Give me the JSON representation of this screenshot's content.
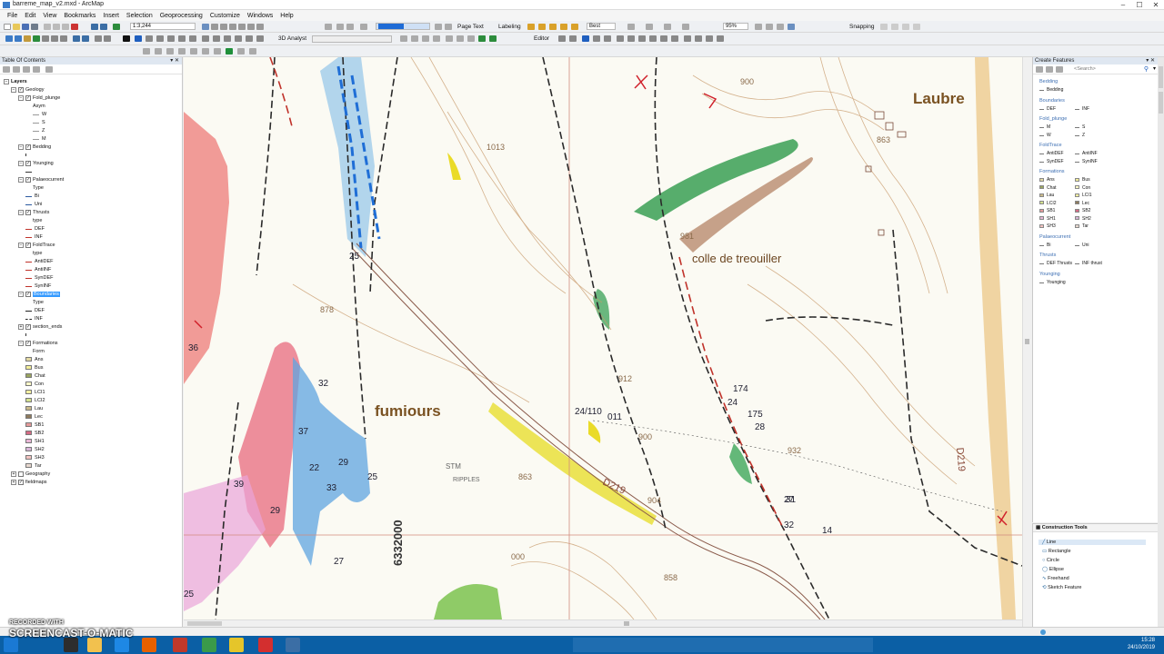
{
  "window": {
    "title": "barreme_map_v2.mxd - ArcMap"
  },
  "menu": [
    "File",
    "Edit",
    "View",
    "Bookmarks",
    "Insert",
    "Selection",
    "Geoprocessing",
    "Customize",
    "Windows",
    "Help"
  ],
  "toolbar": {
    "scale_value": "1:3,244",
    "page_text_label": "Page Text",
    "labeling_label": "Labeling",
    "best_label": "Best",
    "analyst_label": "3D Analyst",
    "editor_label": "Editor",
    "snapping_label": "Snapping",
    "zoom_value": "95%"
  },
  "toc": {
    "title": "Table Of Contents",
    "rows": [
      {
        "indent": 1,
        "expand": "-",
        "check": "",
        "label": "Layers",
        "bold": true
      },
      {
        "indent": 2,
        "expand": "-",
        "check": "✓",
        "label": "Geology"
      },
      {
        "indent": 3,
        "expand": "-",
        "check": "✓",
        "label": "Fold_plunge"
      },
      {
        "indent": 5,
        "label": "Asym"
      },
      {
        "indent": 5,
        "sym": "line-grey",
        "label": "W"
      },
      {
        "indent": 5,
        "sym": "line-grey",
        "label": "S"
      },
      {
        "indent": 5,
        "sym": "line-grey",
        "label": "Z"
      },
      {
        "indent": 5,
        "sym": "line-grey",
        "label": "M"
      },
      {
        "indent": 3,
        "expand": "-",
        "check": "✓",
        "label": "Bedding"
      },
      {
        "indent": 4,
        "sym": "tick",
        "label": ""
      },
      {
        "indent": 3,
        "expand": "-",
        "check": "✓",
        "label": "Younging"
      },
      {
        "indent": 4,
        "sym": "arrow",
        "label": ""
      },
      {
        "indent": 3,
        "expand": "-",
        "check": "✓",
        "label": "Palaeocurrent"
      },
      {
        "indent": 5,
        "label": "Type"
      },
      {
        "indent": 4,
        "sym": "line-blue",
        "label": "Bi"
      },
      {
        "indent": 4,
        "sym": "line-blue",
        "label": "Uni"
      },
      {
        "indent": 3,
        "expand": "-",
        "check": "✓",
        "label": "Thrusts"
      },
      {
        "indent": 5,
        "label": "type"
      },
      {
        "indent": 4,
        "sym": "line-red",
        "label": "DEF"
      },
      {
        "indent": 4,
        "sym": "line-red",
        "label": "INF"
      },
      {
        "indent": 3,
        "expand": "-",
        "check": "✓",
        "label": "FoldTrace"
      },
      {
        "indent": 5,
        "label": "type"
      },
      {
        "indent": 4,
        "sym": "line-red",
        "label": "AntiDEF"
      },
      {
        "indent": 4,
        "sym": "line-red",
        "label": "AntiINF"
      },
      {
        "indent": 4,
        "sym": "line-red",
        "label": "SynDEF"
      },
      {
        "indent": 4,
        "sym": "line-red",
        "label": "SynINF"
      },
      {
        "indent": 3,
        "expand": "-",
        "check": "✓",
        "label": "Boundaries",
        "selected": true
      },
      {
        "indent": 5,
        "label": "Type"
      },
      {
        "indent": 4,
        "sym": "line-black",
        "label": "DEF"
      },
      {
        "indent": 4,
        "sym": "line-dash",
        "label": "INF"
      },
      {
        "indent": 3,
        "expand": "+",
        "check": "✓",
        "label": "section_ends"
      },
      {
        "indent": 4,
        "sym": "tick",
        "label": ""
      },
      {
        "indent": 3,
        "expand": "-",
        "check": "✓",
        "label": "Formations"
      },
      {
        "indent": 5,
        "label": "Form"
      },
      {
        "indent": 4,
        "color": "#e3d9a5",
        "label": "Ans"
      },
      {
        "indent": 4,
        "color": "#f3ee9a",
        "label": "Bus"
      },
      {
        "indent": 4,
        "color": "#9aa560",
        "label": "Chat"
      },
      {
        "indent": 4,
        "color": "#fbf8c8",
        "label": "Con"
      },
      {
        "indent": 4,
        "color": "#f3efa1",
        "label": "LCI1"
      },
      {
        "indent": 4,
        "color": "#d3e18e",
        "label": "LCI2"
      },
      {
        "indent": 4,
        "color": "#c9b98a",
        "label": "Lau"
      },
      {
        "indent": 4,
        "color": "#8f7b5e",
        "label": "Lec"
      },
      {
        "indent": 4,
        "color": "#e39a9a",
        "label": "SB1"
      },
      {
        "indent": 4,
        "color": "#d56b84",
        "label": "SB2"
      },
      {
        "indent": 4,
        "color": "#e7b7d6",
        "label": "SH1"
      },
      {
        "indent": 4,
        "color": "#d8b6d8",
        "label": "SH2"
      },
      {
        "indent": 4,
        "color": "#f2c3c0",
        "label": "SH3"
      },
      {
        "indent": 4,
        "color": "#e7d8cf",
        "label": "Tar"
      },
      {
        "indent": 2,
        "expand": "+",
        "check": "",
        "label": "Geography"
      },
      {
        "indent": 2,
        "expand": "+",
        "check": "✓",
        "label": "fieldmaps"
      }
    ]
  },
  "map": {
    "labels": {
      "laubre": "Laubre",
      "colle": "colle de treouiller",
      "fumiours": "fumiours",
      "northing": "6332000",
      "d219": "D219",
      "d219b": "D219",
      "stm": "STM",
      "ripples": "RIPPLES"
    },
    "spot_heights": [
      "1013",
      "981",
      "878",
      "912",
      "900",
      "863",
      "932",
      "858",
      "904",
      "863",
      "900",
      "000"
    ],
    "dips": [
      "32",
      "37",
      "22",
      "29",
      "33",
      "39",
      "29",
      "27",
      "25",
      "14",
      "25",
      "28",
      "32",
      "24",
      "27",
      "174",
      "175",
      "24/110",
      "011",
      "25",
      "31",
      "36"
    ]
  },
  "create_features": {
    "title": "Create Features",
    "search_placeholder": "<Search>",
    "groups": [
      {
        "name": "Bedding",
        "items": [
          [
            "Bedding",
            ""
          ]
        ]
      },
      {
        "name": "Boundaries",
        "items": [
          [
            "DEF",
            "INF"
          ]
        ]
      },
      {
        "name": "Fold_plunge",
        "items": [
          [
            "M",
            "S"
          ],
          [
            "W",
            "Z"
          ]
        ]
      },
      {
        "name": "FoldTrace",
        "items": [
          [
            "AntiDEF",
            "AntiINF"
          ],
          [
            "SynDEF",
            "SynINF"
          ]
        ]
      },
      {
        "name": "Formations",
        "items": [
          [
            "Ans",
            "Bus"
          ],
          [
            "Chat",
            "Con"
          ],
          [
            "Lau",
            "LCI1"
          ],
          [
            "LCI2",
            "Lec"
          ],
          [
            "SB1",
            "SB2"
          ],
          [
            "SH1",
            "SH2"
          ],
          [
            "SH3",
            "Tar"
          ]
        ]
      },
      {
        "name": "Palaeocurrent",
        "items": [
          [
            "Bi",
            "Uni"
          ]
        ]
      },
      {
        "name": "Thrusts",
        "items": [
          [
            "DEF Thrusts",
            "INF thrust"
          ]
        ]
      },
      {
        "name": "Younging",
        "items": [
          [
            "Younging",
            ""
          ]
        ]
      }
    ],
    "formation_colors": {
      "Ans": "#e3d9a5",
      "Bus": "#f3ee9a",
      "Chat": "#9aa560",
      "Con": "#fbf8c8",
      "Lau": "#c9b98a",
      "LCI1": "#f3efa1",
      "LCI2": "#d3e18e",
      "Lec": "#8f7b5e",
      "SB1": "#e39a9a",
      "SB2": "#d56b84",
      "SH1": "#e7b7d6",
      "SH2": "#d8b6d8",
      "SH3": "#f2c3c0",
      "Tar": "#e7d8cf"
    }
  },
  "construction_tools": {
    "title": "Construction Tools",
    "items": [
      "Line",
      "Rectangle",
      "Circle",
      "Ellipse",
      "Freehand",
      "Sketch Feature"
    ]
  },
  "taskbar": {
    "time": "15:28",
    "date": "24/10/2019",
    "watermark_top": "RECORDED WITH",
    "watermark_bottom": "SCREENCAST-O-MATIC"
  }
}
